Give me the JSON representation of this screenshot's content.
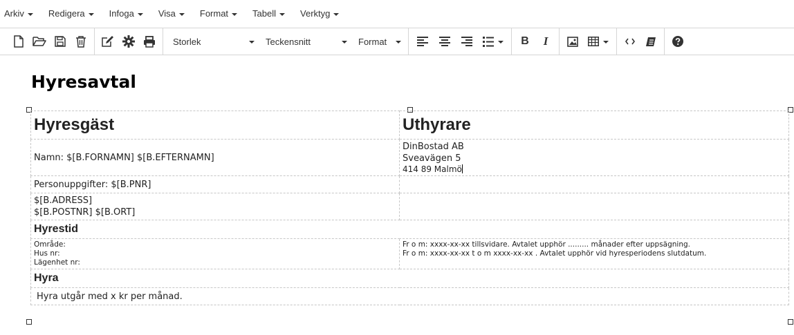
{
  "menubar": {
    "items": [
      {
        "label": "Arkiv"
      },
      {
        "label": "Redigera"
      },
      {
        "label": "Infoga"
      },
      {
        "label": "Visa"
      },
      {
        "label": "Format"
      },
      {
        "label": "Tabell"
      },
      {
        "label": "Verktyg"
      }
    ]
  },
  "toolbar": {
    "size_label": "Storlek",
    "font_label": "Teckensnitt",
    "format_label": "Format",
    "bold_label": "B",
    "italic_label": "I",
    "icons": [
      "new-document-icon",
      "open-folder-icon",
      "save-icon",
      "delete-icon",
      "edit-icon",
      "settings-icon",
      "print-icon",
      "align-left-icon",
      "align-center-icon",
      "align-right-icon",
      "bullet-list-icon",
      "image-icon",
      "table-icon",
      "code-icon",
      "clear-format-icon",
      "help-icon"
    ]
  },
  "document": {
    "title": "Hyresavtal",
    "tenant_heading": "Hyresgäst",
    "landlord_heading": "Uthyrare",
    "name_line": "Namn: $[B.FORNAMN] $[B.EFTERNAMN]",
    "landlord_lines": [
      "DinBostad AB",
      "Sveavägen 5",
      "414 89 Malmö"
    ],
    "personal_line": "Personuppgifter: $[B.PNR]",
    "address_lines": [
      "$[B.ADRESS]",
      "$[B.POSTNR]  $[B.ORT]"
    ],
    "term_heading": "Hyrestid",
    "location_lines": [
      "Område:",
      "Hus nr:",
      "Lägenhet nr:"
    ],
    "term_lines": [
      "Fr o m: xxxx-xx-xx tillsvidare. Avtalet upphör ......... månader efter uppsägning.",
      "Fr o m: xxxx-xx-xx  t o m xxxx-xx-xx . Avtalet upphör vid hyresperiodens slutdatum."
    ],
    "rent_heading": "Hyra",
    "rent_line": "Hyra utgår med x kr per månad."
  }
}
